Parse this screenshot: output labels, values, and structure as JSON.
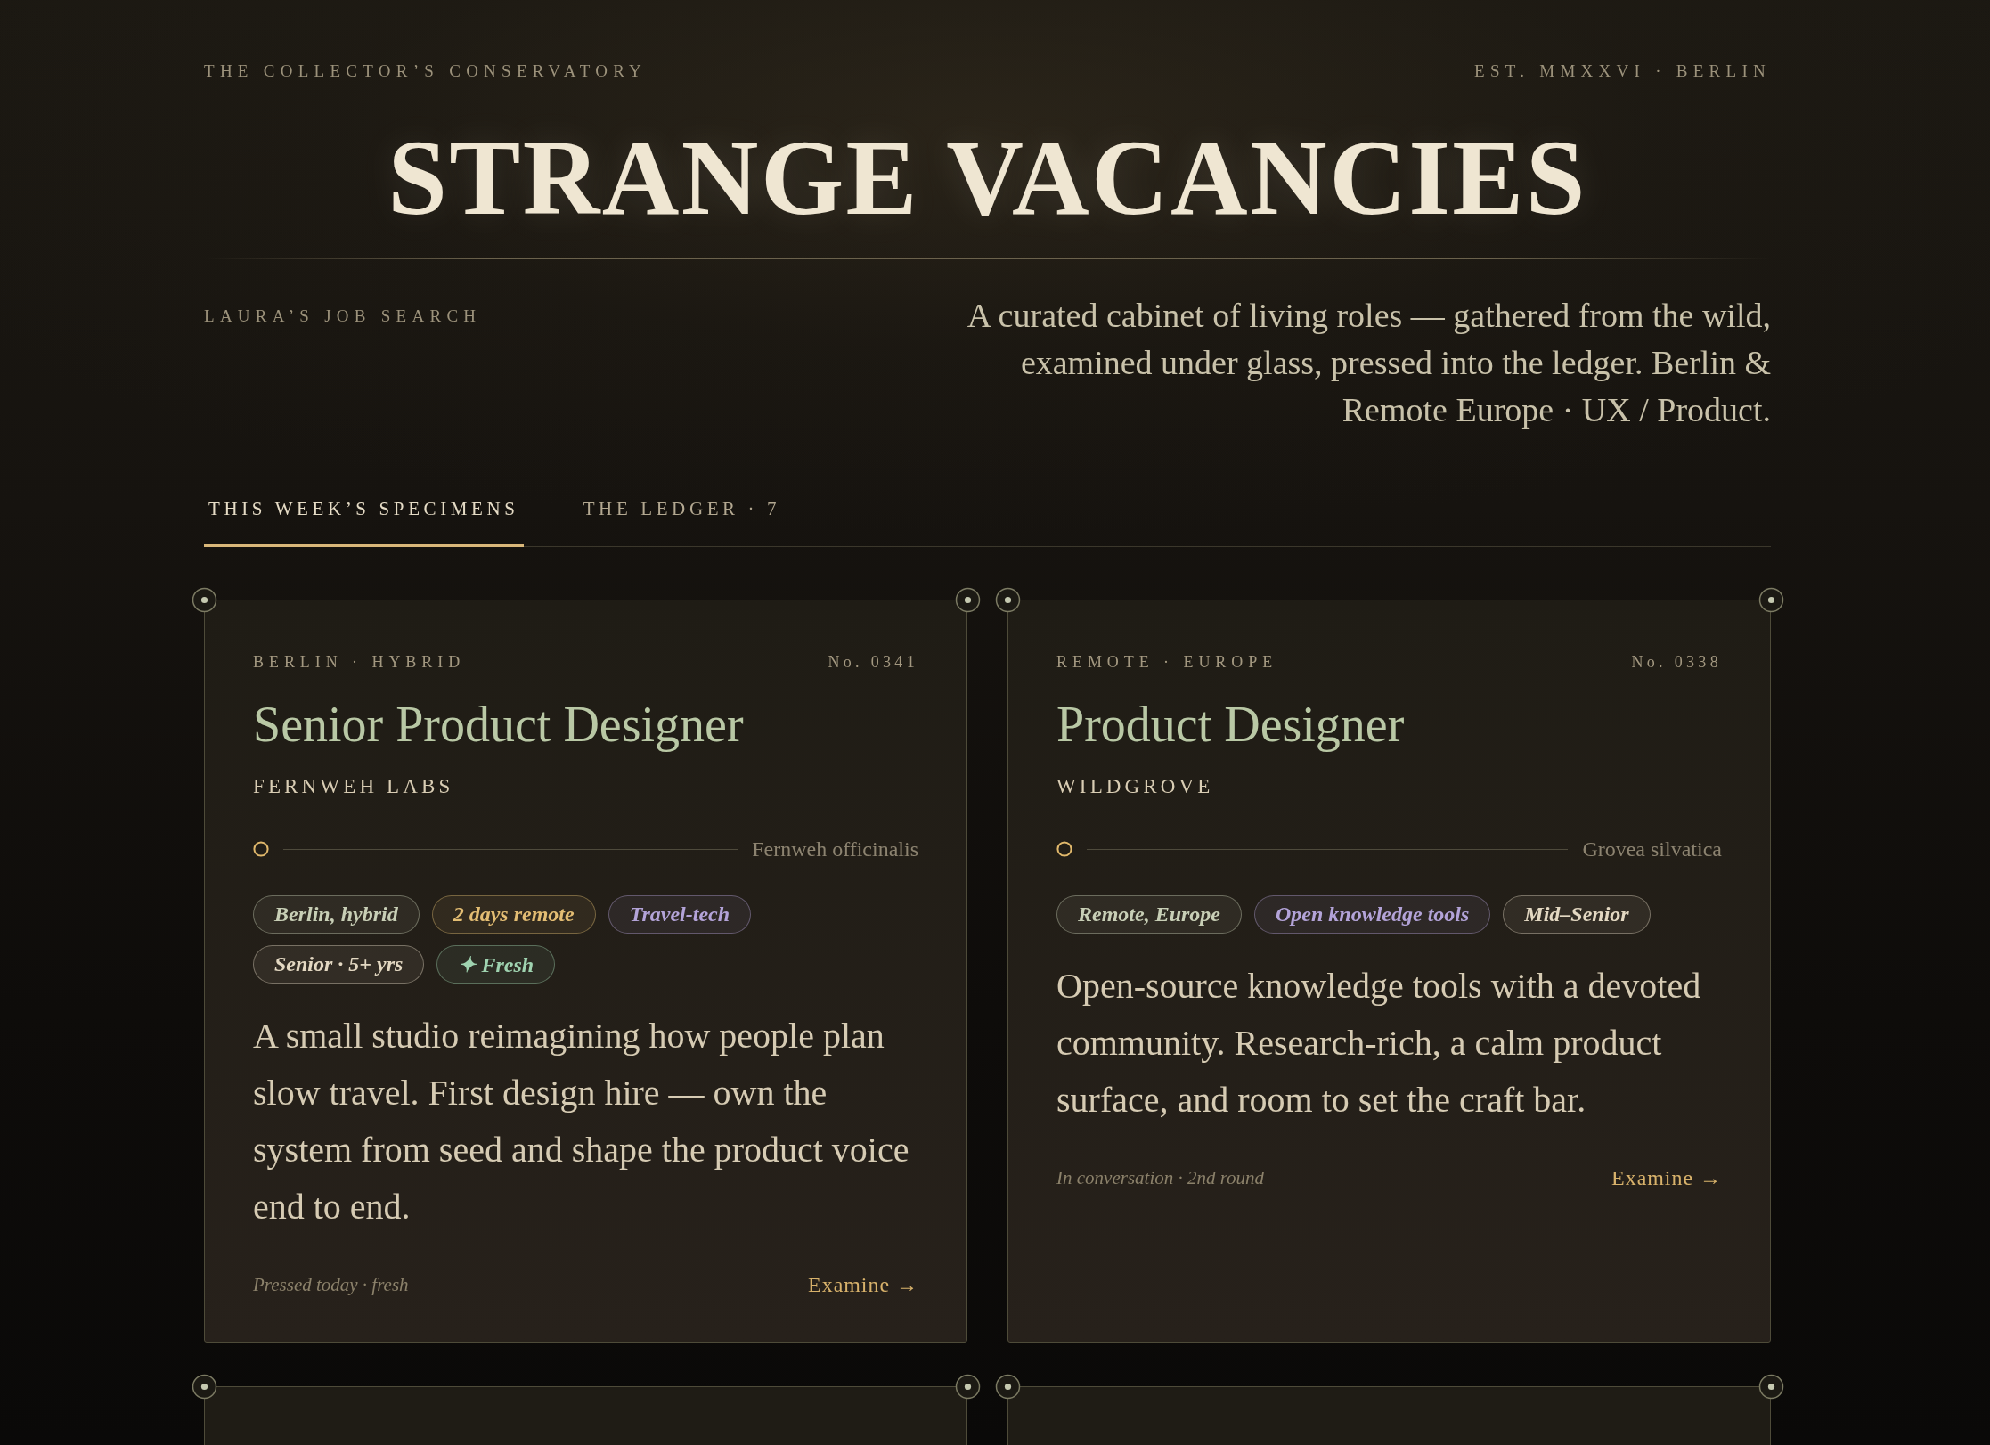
{
  "header": {
    "brand": "THE COLLECTOR’S CONSERVATORY",
    "established": "EST. MMXXVI · BERLIN",
    "title": "STRANGE VACANCIES",
    "owner": "LAURA’S JOB SEARCH",
    "intro": "A curated cabinet of living roles — gathered from the wild, examined under glass, pressed into the ledger. Berlin & Remote Europe · UX / Product."
  },
  "tabs": [
    {
      "label": "THIS WEEK’S SPECIMENS",
      "selected": true
    },
    {
      "label": "THE LEDGER · 7",
      "selected": false
    }
  ],
  "cards": [
    {
      "location": "BERLIN · HYBRID",
      "number": "No. 0341",
      "title": "Senior Product Designer",
      "company": "FERNWEH LABS",
      "specimen": "Fernweh officinalis",
      "tags": [
        {
          "label": "Berlin, hybrid",
          "color": "#c8cfb6"
        },
        {
          "label": "2 days remote",
          "color": "#e3bd73"
        },
        {
          "label": "Travel-tech",
          "color": "#b3a3d8"
        },
        {
          "label": "Senior · 5+ yrs",
          "color": "#e3d8c2"
        },
        {
          "label": "✦ Fresh",
          "color": "#9fd3b0"
        }
      ],
      "description": "A small studio reimagining how people plan slow travel. First design hire — own the system from seed and shape the product voice end to end.",
      "status": "Pressed today · fresh",
      "action": "Examine →"
    },
    {
      "location": "REMOTE · EUROPE",
      "number": "No. 0338",
      "title": "Product Designer",
      "company": "WILDGROVE",
      "specimen": "Grovea silvatica",
      "tags": [
        {
          "label": "Remote, Europe",
          "color": "#c8cfb6"
        },
        {
          "label": "Open knowledge tools",
          "color": "#b3a3d8"
        },
        {
          "label": "Mid–Senior",
          "color": "#e3d8c2"
        }
      ],
      "description": "Open-source knowledge tools with a devoted community. Research-rich, a calm product surface, and room to set the craft bar.",
      "status": "In conversation · 2nd round",
      "action": "Examine →"
    }
  ]
}
